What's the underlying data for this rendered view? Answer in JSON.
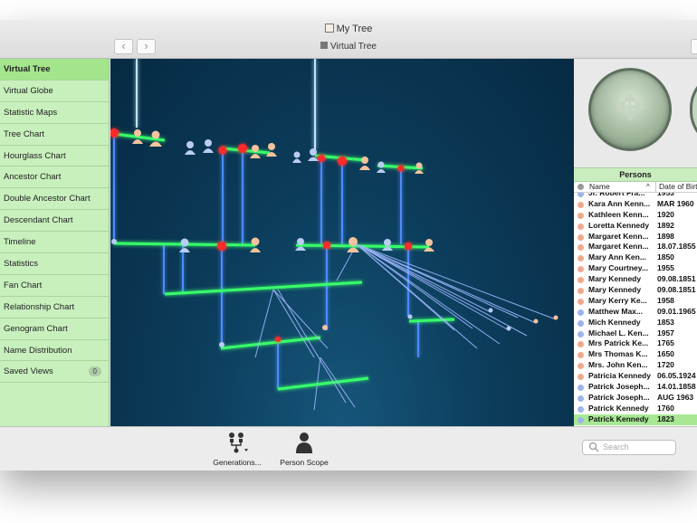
{
  "window": {
    "title": "My Tree",
    "subtitle": "Virtual Tree"
  },
  "toolbar": {
    "back_icon": "chevron-left-icon",
    "forward_icon": "chevron-right-icon"
  },
  "sidebar": {
    "items": [
      {
        "label": "Virtual Tree",
        "active": true
      },
      {
        "label": "Virtual Globe"
      },
      {
        "label": "Statistic Maps"
      },
      {
        "label": "Tree Chart"
      },
      {
        "label": "Hourglass Chart"
      },
      {
        "label": "Ancestor Chart"
      },
      {
        "label": "Double Ancestor Chart"
      },
      {
        "label": "Descendant Chart"
      },
      {
        "label": "Timeline"
      },
      {
        "label": "Statistics"
      },
      {
        "label": "Fan Chart"
      },
      {
        "label": "Relationship Chart"
      },
      {
        "label": "Genogram Chart"
      },
      {
        "label": "Name Distribution"
      },
      {
        "label": "Saved Views",
        "badge": "0"
      }
    ]
  },
  "persons": {
    "title": "Persons",
    "col_name": "Name",
    "col_date": "Date of Birth",
    "sort_indicator": "^",
    "rows": [
      {
        "name": "Jr. Robert Fra...",
        "date": "1953",
        "gender": "male"
      },
      {
        "name": "Kara Ann Kenn...",
        "date": "MAR 1960",
        "gender": "female"
      },
      {
        "name": "Kathleen Kenn...",
        "date": "1920",
        "gender": "female"
      },
      {
        "name": "Loretta Kennedy",
        "date": "1892",
        "gender": "female"
      },
      {
        "name": "Margaret Kenn...",
        "date": "1898",
        "gender": "female"
      },
      {
        "name": "Margaret Kenn...",
        "date": "18.07.1855",
        "gender": "female"
      },
      {
        "name": "Mary Ann Ken...",
        "date": "1850",
        "gender": "female"
      },
      {
        "name": "Mary Courtney...",
        "date": "1955",
        "gender": "female"
      },
      {
        "name": "Mary Kennedy",
        "date": "09.08.1851",
        "gender": "female"
      },
      {
        "name": "Mary Kennedy",
        "date": "09.08.1851",
        "gender": "female"
      },
      {
        "name": "Mary Kerry Ke...",
        "date": "1958",
        "gender": "female"
      },
      {
        "name": "Matthew Max...",
        "date": "09.01.1965",
        "gender": "male"
      },
      {
        "name": "Mich Kennedy",
        "date": "1853",
        "gender": "male"
      },
      {
        "name": "Michael L. Ken...",
        "date": "1957",
        "gender": "male"
      },
      {
        "name": "Mrs Patrick Ke...",
        "date": "1765",
        "gender": "female"
      },
      {
        "name": "Mrs Thomas K...",
        "date": "1650",
        "gender": "female"
      },
      {
        "name": "Mrs. John Ken...",
        "date": "1720",
        "gender": "female"
      },
      {
        "name": "Patricia Kennedy",
        "date": "06.05.1924",
        "gender": "female"
      },
      {
        "name": "Patrick Joseph...",
        "date": "14.01.1858",
        "gender": "male"
      },
      {
        "name": "Patrick Joseph...",
        "date": "AUG 1963",
        "gender": "male"
      },
      {
        "name": "Patrick Kennedy",
        "date": "1760",
        "gender": "male"
      },
      {
        "name": "Patrick Kennedy",
        "date": "1823",
        "gender": "male",
        "selected": true
      }
    ]
  },
  "bottom": {
    "generations_label": "Generations...",
    "person_scope_label": "Person Scope",
    "search_placeholder": "Search"
  },
  "colors": {
    "male": "#9bb4ea",
    "female": "#f0a98d",
    "sidebar_bg": "#c8f0bd",
    "selected_row": "#a8e894"
  }
}
